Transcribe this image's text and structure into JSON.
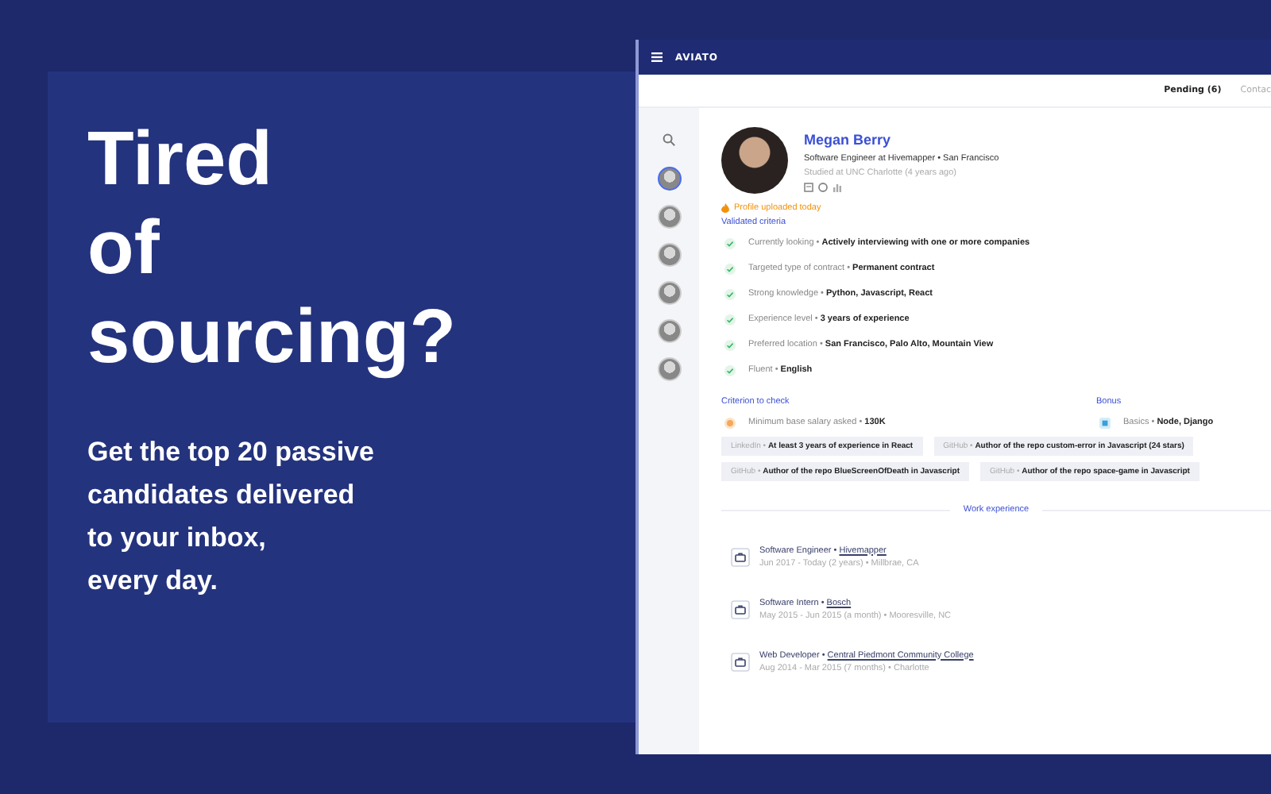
{
  "hero": {
    "headline_lines": [
      "Tired",
      "of",
      "sourcing?"
    ],
    "subheadline_lines": [
      "Get the top 20 passive",
      "candidates delivered",
      "to your inbox,",
      "every day."
    ]
  },
  "app": {
    "brand": "AVIATO",
    "tabs": [
      {
        "label": "Pending (6)",
        "selected": true
      },
      {
        "label": "Contac",
        "selected": false
      }
    ],
    "candidates": [
      {
        "selected": true
      },
      {
        "selected": false
      },
      {
        "selected": false
      },
      {
        "selected": false
      },
      {
        "selected": false
      },
      {
        "selected": false
      }
    ],
    "profile": {
      "name": "Megan Berry",
      "headline": "Software Engineer at Hivemapper • San Francisco",
      "education": "Studied at UNC Charlotte (4 years ago)",
      "badge": "Profile uploaded today"
    },
    "validated_criteria": {
      "title": "Validated criteria",
      "items": [
        {
          "label": "Currently looking •",
          "value": "Actively interviewing with one or more companies"
        },
        {
          "label": "Targeted type of contract •",
          "value": "Permanent contract"
        },
        {
          "label": "Strong knowledge •",
          "value": "Python, Javascript, React"
        },
        {
          "label": "Experience level •",
          "value": "3 years of experience"
        },
        {
          "label": "Preferred location •",
          "value": "San Francisco, Palo Alto, Mountain View"
        },
        {
          "label": "Fluent •",
          "value": "English"
        }
      ]
    },
    "criterion_to_check": {
      "title": "Criterion to check",
      "items": [
        {
          "label": "Minimum base salary asked •",
          "value": "130K"
        }
      ]
    },
    "bonus": {
      "title": "Bonus",
      "items": [
        {
          "label": "Basics •",
          "value": "Node, Django"
        }
      ]
    },
    "tags": [
      {
        "source": "LinkedIn •",
        "text": "At least 3 years of experience in React"
      },
      {
        "source": "GitHub •",
        "text": "Author of the repo custom-error in Javascript (24 stars)"
      },
      {
        "source": "GitHub •",
        "text": "Author of the repo BlueScreenOfDeath in Javascript"
      },
      {
        "source": "GitHub •",
        "text": "Author of the repo space-game in Javascript"
      }
    ],
    "work_experience": {
      "title": "Work experience",
      "jobs": [
        {
          "title": "Software Engineer •",
          "company": "Hivemapper",
          "details": "Jun 2017 - Today (2 years) • Millbrae, CA"
        },
        {
          "title": "Software Intern •",
          "company": "Bosch",
          "details": "May 2015 - Jun 2015 (a month) • Mooresville, NC"
        },
        {
          "title": "Web Developer •",
          "company": "Central Piedmont Community College",
          "details": "Aug 2014 - Mar 2015 (7 months) • Charlotte"
        }
      ]
    }
  }
}
